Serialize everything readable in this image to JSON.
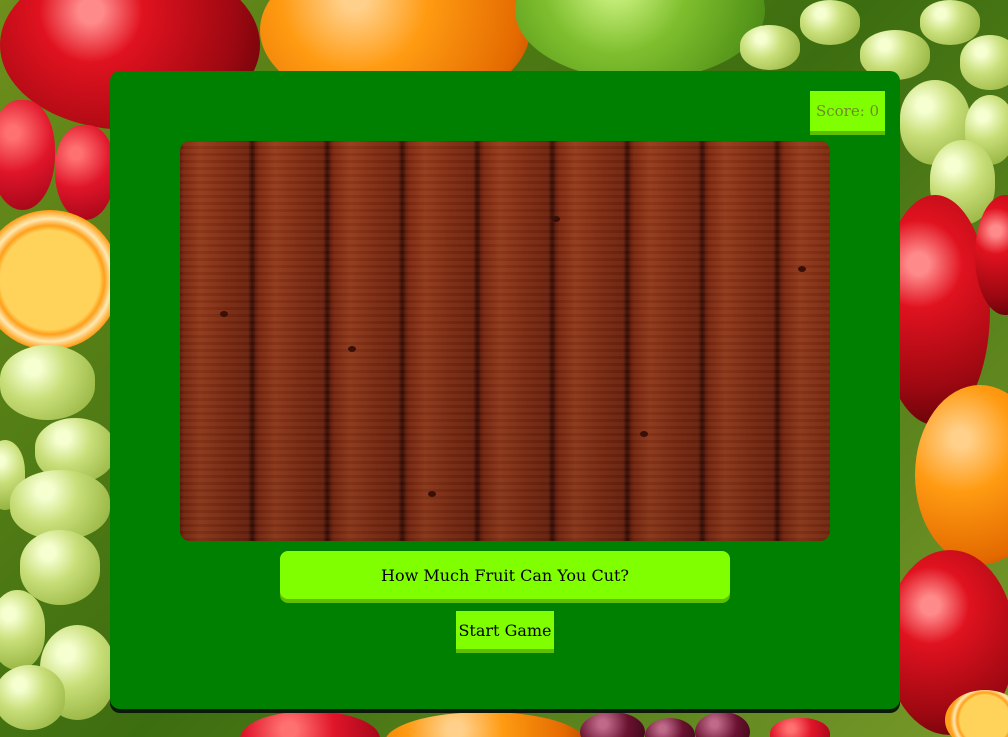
{
  "game": {
    "title": "How Much Fruit Can You Cut?",
    "score_label": "Score: 0",
    "score_value": 0,
    "start_button_label": "Start Game"
  },
  "colors": {
    "panel": "#008000",
    "accent": "#80ff00",
    "score_text": "#6b8e23",
    "board_wood": "#8a2c12"
  },
  "background": {
    "theme": "fruit-collage-icon"
  }
}
